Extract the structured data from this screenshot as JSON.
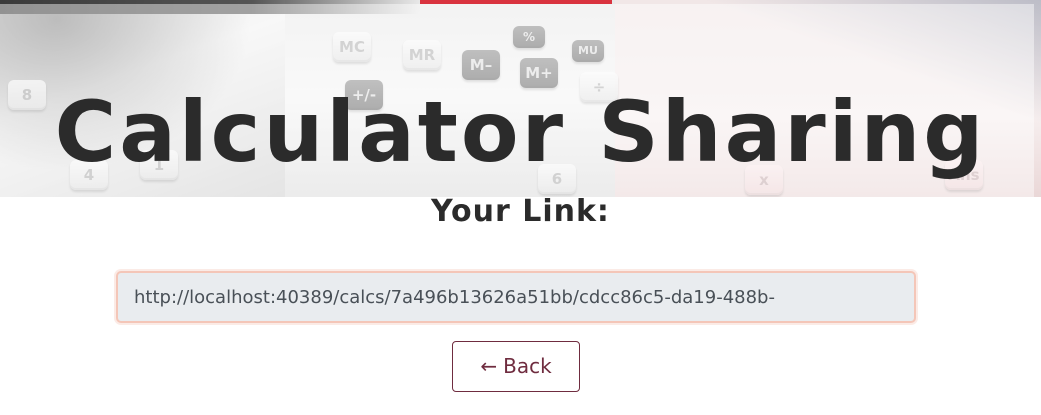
{
  "hero": {
    "title": "Calculator Sharing",
    "keys": [
      {
        "label": "MC",
        "style": "light"
      },
      {
        "label": "MR",
        "style": "light"
      },
      {
        "label": "M–",
        "style": "dark"
      },
      {
        "label": "M+",
        "style": "dark"
      },
      {
        "label": "%",
        "style": "dark"
      },
      {
        "label": "MU",
        "style": "dark"
      },
      {
        "label": "÷",
        "style": "light"
      },
      {
        "label": "8",
        "style": "light"
      },
      {
        "label": "4",
        "style": "light"
      },
      {
        "label": "1",
        "style": "light"
      },
      {
        "label": "6",
        "style": "light"
      },
      {
        "label": "Ans",
        "style": "pink"
      },
      {
        "label": "x",
        "style": "pink"
      },
      {
        "label": "+/-",
        "style": "dark"
      }
    ]
  },
  "content": {
    "subtitle": "Your Link:",
    "link_value": "http://localhost:40389/calcs/7a496b13626a51bb/cdcc86c5-da19-488b-",
    "back_arrow": "←",
    "back_label": "Back"
  },
  "colors": {
    "accent_red": "#d9333f",
    "back_button": "#6f2c3f",
    "title_text": "#2b2b2b",
    "input_border": "#f4c6b8",
    "input_bg": "#e9ecef"
  }
}
